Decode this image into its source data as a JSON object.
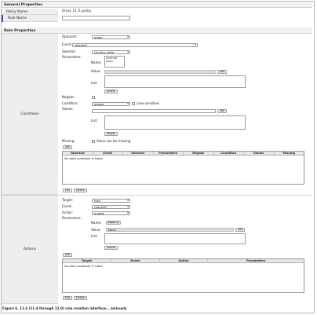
{
  "general": {
    "heading": "General Properties",
    "policy_name_label": "Policy Name",
    "policy_name_value": "Gross_11_6_policy",
    "rule_name_label": "Rule Name",
    "rule_name_value": ""
  },
  "rule": {
    "heading": "Rule Properties",
    "conditions_label": "Conditions",
    "actions_label": "Actions"
  },
  "conditions": {
    "operand_label": "Operand:",
    "operand_value": "geoip",
    "event_label": "Event:",
    "event_value": "request*",
    "selector_label": "Selector:",
    "selector_value": "country-code",
    "parameters_label": "Parameters:",
    "name_label": "Name:",
    "name_options": [
      "internal",
      "local"
    ],
    "value_label": "Value:",
    "add_label": "Add",
    "list_label": "List:",
    "delete_label": "Delete",
    "negate_label": "Negate:",
    "condition_label": "Condition:",
    "condition_value": "equals",
    "case_sensitive_label": "case sensitive",
    "values_label": "Values:",
    "values_add_label": "Add",
    "values_list_label": "List:",
    "values_delete_label": "Delete",
    "missing_label": "Missing:",
    "missing_checkbox_label": "Value can be missing",
    "table_add_label": "Add",
    "table_columns": [
      "Operand",
      "Event",
      "Selector",
      "Parameters",
      "Negate",
      "Condition",
      "Values",
      "Missing"
    ],
    "table_empty": "No data available in table",
    "edit_label": "Edit",
    "delete_table_label": "Delete"
  },
  "actions": {
    "target_label": "Target:",
    "target_value": "http",
    "event_label": "Event:",
    "event_value": "request*",
    "action_label": "Action:",
    "action_value": "enable",
    "parameters_label": "Parameters:",
    "name_label": "Name:",
    "name_value": "None",
    "value_label": "Value:",
    "value_value": "None",
    "add_label": "Add",
    "list_label": "List:",
    "delete_label": "Delete",
    "table_add_label": "Add",
    "table_columns": [
      "Target",
      "Event",
      "Action",
      "Parameters"
    ],
    "table_empty": "No data available in table",
    "edit_label": "Edit",
    "delete_table_label": "Delete"
  },
  "caption": "Figure 6.  11.6 (11.4 through 12.0) rule creation interface… seriously",
  "colors": {
    "accent": "#2d5f9e",
    "header_bg": "#f1f1f1",
    "label_bg": "#eeeeee"
  }
}
